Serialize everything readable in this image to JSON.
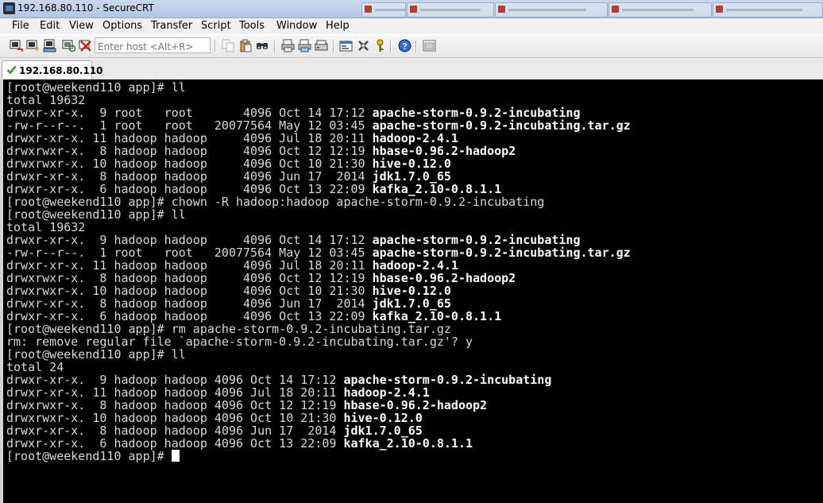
{
  "window": {
    "title": "192.168.80.110 - SecureCRT"
  },
  "menu": [
    "File",
    "Edit",
    "View",
    "Options",
    "Transfer",
    "Script",
    "Tools",
    "Window",
    "Help"
  ],
  "toolbar": {
    "host_placeholder": "Enter host <Alt+R>",
    "icons": [
      "connect-icon",
      "quick-connect-icon",
      "connect-in-tab-icon",
      "reconnect-icon",
      "disconnect-icon",
      "copy-icon",
      "paste-icon",
      "find-icon",
      "print-icon",
      "print-setup-icon",
      "session-options-icon",
      "global-options-icon",
      "keymap-icon",
      "help-icon",
      "keygen-icon"
    ]
  },
  "tabs": [
    {
      "label": "192.168.80.110",
      "status_icon": "check-icon",
      "active": true
    }
  ],
  "terminal": {
    "lines": [
      {
        "text": "[root@weekend110 app]# ll",
        "name": ""
      },
      {
        "text": "total 19632",
        "name": ""
      },
      {
        "text": "drwxr-xr-x.  9 root   root       4096 Oct 14 17:12 ",
        "name": "apache-storm-0.9.2-incubating"
      },
      {
        "text": "-rw-r--r--.  1 root   root   20077564 May 12 03:45 ",
        "name": "apache-storm-0.9.2-incubating.tar.gz"
      },
      {
        "text": "drwxr-xr-x. 11 hadoop hadoop     4096 Jul 18 20:11 ",
        "name": "hadoop-2.4.1"
      },
      {
        "text": "drwxrwxr-x.  8 hadoop hadoop     4096 Oct 12 12:19 ",
        "name": "hbase-0.96.2-hadoop2"
      },
      {
        "text": "drwxrwxr-x. 10 hadoop hadoop     4096 Oct 10 21:30 ",
        "name": "hive-0.12.0"
      },
      {
        "text": "drwxr-xr-x.  8 hadoop hadoop     4096 Jun 17  2014 ",
        "name": "jdk1.7.0_65"
      },
      {
        "text": "drwxr-xr-x.  6 hadoop hadoop     4096 Oct 13 22:09 ",
        "name": "kafka_2.10-0.8.1.1"
      },
      {
        "text": "[root@weekend110 app]# chown -R hadoop:hadoop apache-storm-0.9.2-incubating",
        "name": ""
      },
      {
        "text": "[root@weekend110 app]# ll",
        "name": ""
      },
      {
        "text": "total 19632",
        "name": ""
      },
      {
        "text": "drwxr-xr-x.  9 hadoop hadoop     4096 Oct 14 17:12 ",
        "name": "apache-storm-0.9.2-incubating"
      },
      {
        "text": "-rw-r--r--.  1 root   root   20077564 May 12 03:45 ",
        "name": "apache-storm-0.9.2-incubating.tar.gz"
      },
      {
        "text": "drwxr-xr-x. 11 hadoop hadoop     4096 Jul 18 20:11 ",
        "name": "hadoop-2.4.1"
      },
      {
        "text": "drwxrwxr-x.  8 hadoop hadoop     4096 Oct 12 12:19 ",
        "name": "hbase-0.96.2-hadoop2"
      },
      {
        "text": "drwxrwxr-x. 10 hadoop hadoop     4096 Oct 10 21:30 ",
        "name": "hive-0.12.0"
      },
      {
        "text": "drwxr-xr-x.  8 hadoop hadoop     4096 Jun 17  2014 ",
        "name": "jdk1.7.0_65"
      },
      {
        "text": "drwxr-xr-x.  6 hadoop hadoop     4096 Oct 13 22:09 ",
        "name": "kafka_2.10-0.8.1.1"
      },
      {
        "text": "[root@weekend110 app]# rm apache-storm-0.9.2-incubating.tar.gz",
        "name": ""
      },
      {
        "text": "rm: remove regular file `apache-storm-0.9.2-incubating.tar.gz'? y",
        "name": ""
      },
      {
        "text": "[root@weekend110 app]# ll",
        "name": ""
      },
      {
        "text": "total 24",
        "name": ""
      },
      {
        "text": "drwxr-xr-x.  9 hadoop hadoop 4096 Oct 14 17:12 ",
        "name": "apache-storm-0.9.2-incubating"
      },
      {
        "text": "drwxr-xr-x. 11 hadoop hadoop 4096 Jul 18 20:11 ",
        "name": "hadoop-2.4.1"
      },
      {
        "text": "drwxrwxr-x.  8 hadoop hadoop 4096 Oct 12 12:19 ",
        "name": "hbase-0.96.2-hadoop2"
      },
      {
        "text": "drwxrwxr-x. 10 hadoop hadoop 4096 Oct 10 21:30 ",
        "name": "hive-0.12.0"
      },
      {
        "text": "drwxr-xr-x.  8 hadoop hadoop 4096 Jun 17  2014 ",
        "name": "jdk1.7.0_65"
      },
      {
        "text": "drwxr-xr-x.  6 hadoop hadoop 4096 Oct 13 22:09 ",
        "name": "kafka_2.10-0.8.1.1"
      },
      {
        "text": "[root@weekend110 app]# ",
        "name": ""
      }
    ],
    "colors": {
      "background": "#000000",
      "text": "#d8d8d8",
      "bold_text": "#ffffff"
    }
  }
}
